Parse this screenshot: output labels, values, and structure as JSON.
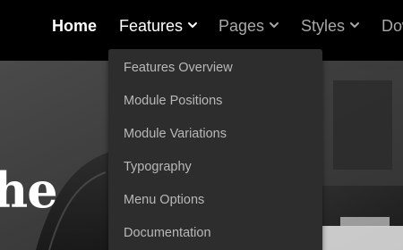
{
  "nav": {
    "home": "Home",
    "features": "Features",
    "pages": "Pages",
    "styles": "Styles",
    "download": "Download"
  },
  "hero": {
    "heading_fragment": "he"
  },
  "dropdown": {
    "items": [
      {
        "label": "Features Overview"
      },
      {
        "label": "Module Positions"
      },
      {
        "label": "Module Variations"
      },
      {
        "label": "Typography"
      },
      {
        "label": "Menu Options"
      },
      {
        "label": "Documentation"
      }
    ]
  },
  "icons": {
    "dropdown_indicator": "chevron-down-icon"
  },
  "colors": {
    "nav_active": "#ffffff",
    "nav_inactive": "#a8a8a8",
    "dropdown_bg": "#2d2d2d",
    "dropdown_text": "#b8b8b8"
  }
}
